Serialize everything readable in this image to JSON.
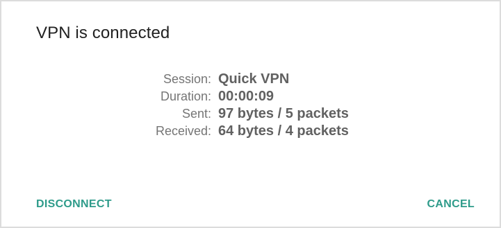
{
  "dialog": {
    "title": "VPN is connected",
    "details": [
      {
        "label": "Session:",
        "value": "Quick VPN"
      },
      {
        "label": "Duration:",
        "value": "00:00:09"
      },
      {
        "label": "Sent:",
        "value": "97 bytes / 5 packets"
      },
      {
        "label": "Received:",
        "value": "64 bytes / 4 packets"
      }
    ],
    "actions": {
      "disconnect_label": "DISCONNECT",
      "cancel_label": "CANCEL"
    }
  },
  "colors": {
    "accent": "#2e9b8a",
    "title_text": "#212121",
    "label_text": "#757575",
    "value_text": "#616161"
  }
}
